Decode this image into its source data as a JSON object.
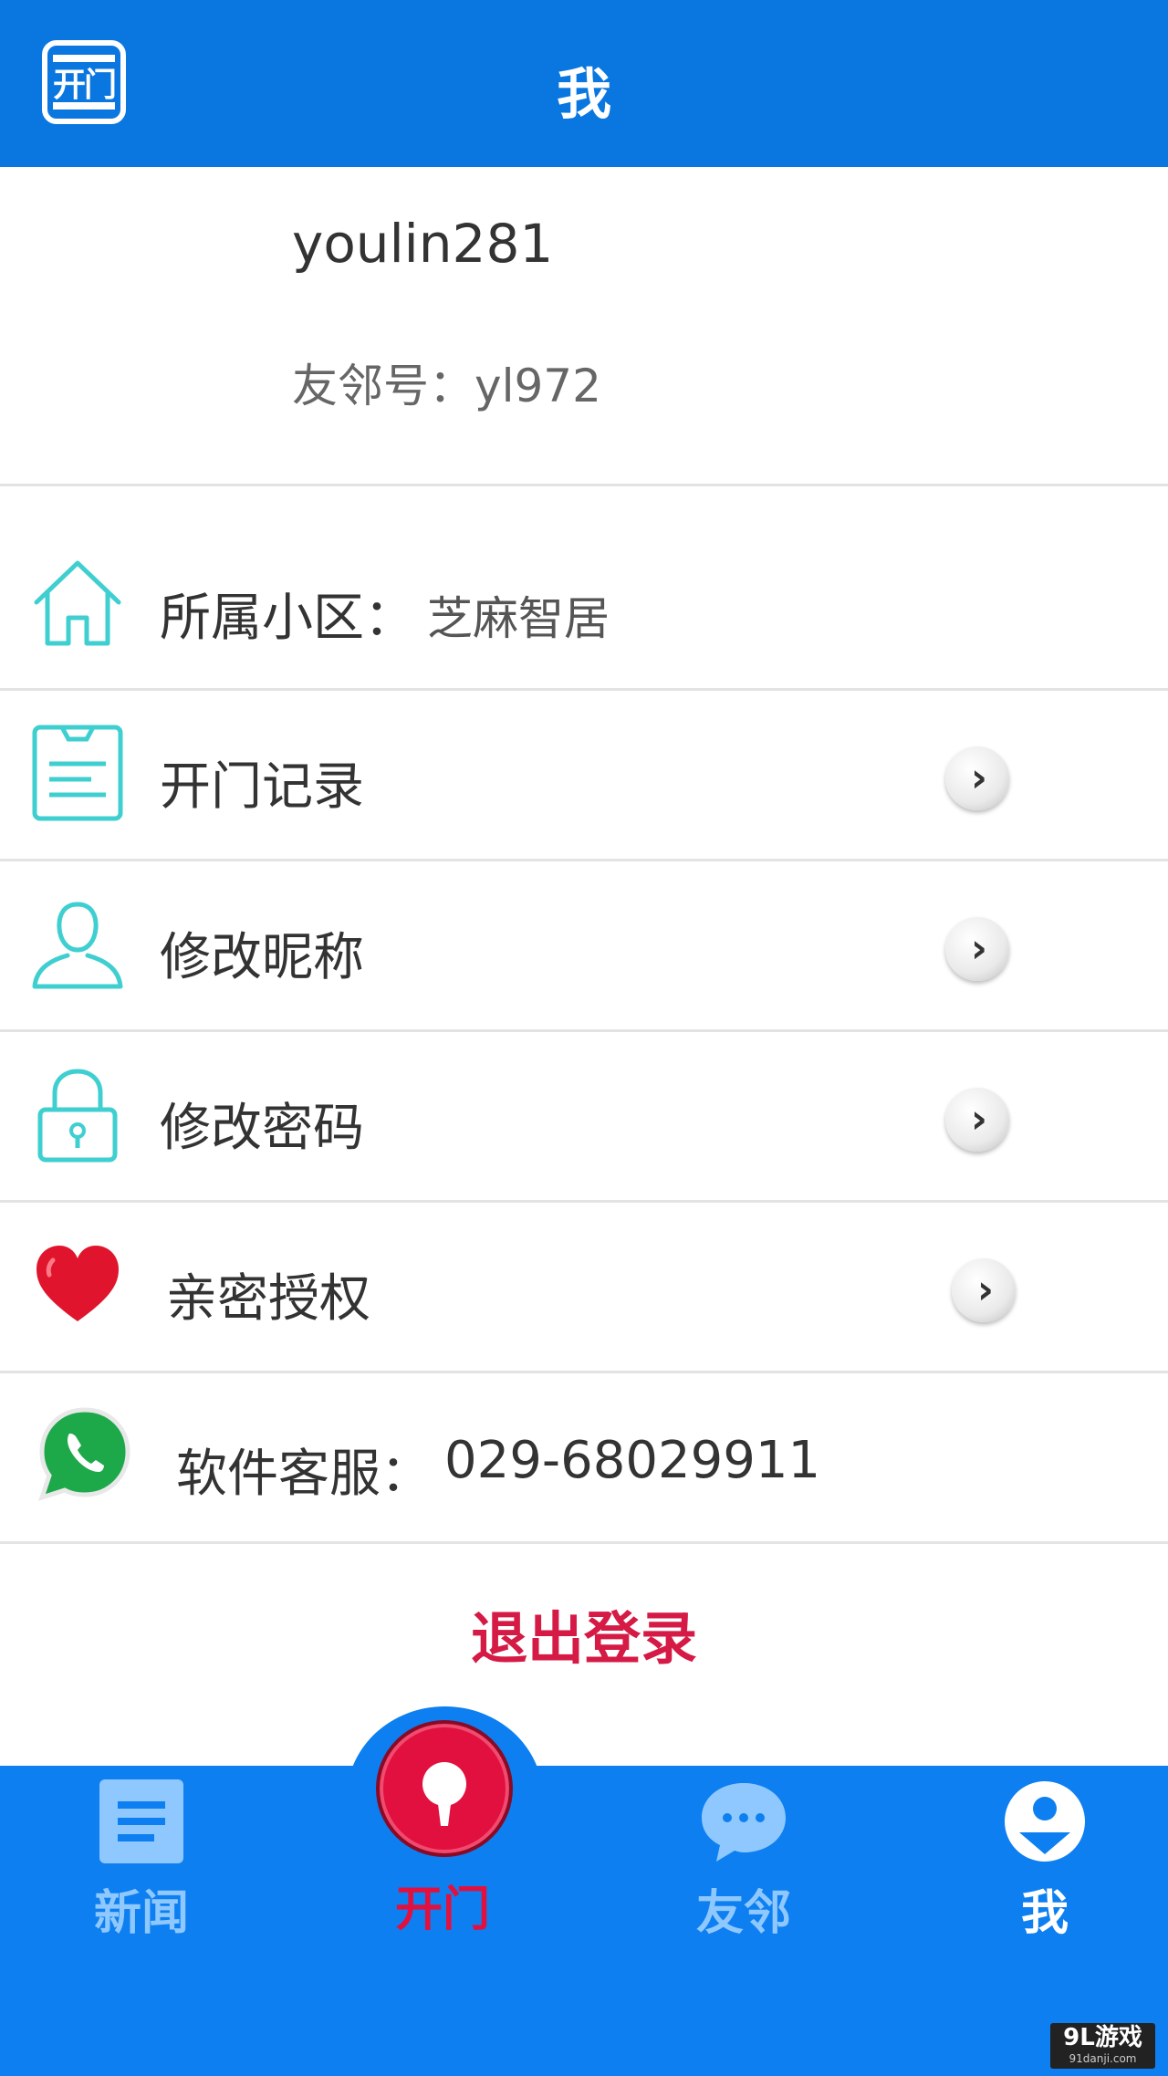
{
  "header": {
    "logo_text": "开门",
    "title": "我"
  },
  "profile": {
    "username": "youlin281",
    "youlin_id": "友邻号：yl972"
  },
  "menu": {
    "community_label": "所属小区：",
    "community_value": "芝麻智居",
    "open_records": "开门记录",
    "edit_nickname": "修改昵称",
    "change_password": "修改密码",
    "intimate_auth": "亲密授权",
    "support_label": "软件客服：",
    "support_phone": "029-68029911"
  },
  "logout": "退出登录",
  "nav": {
    "news": "新闻",
    "open": "开门",
    "neighbors": "友邻",
    "me": "我"
  },
  "watermark": {
    "text": "9L游戏",
    "sub": "91danji.com"
  },
  "colors": {
    "primary": "#0a77e0",
    "accent_red": "#d41a45",
    "icon_teal": "#3fcfd0"
  }
}
